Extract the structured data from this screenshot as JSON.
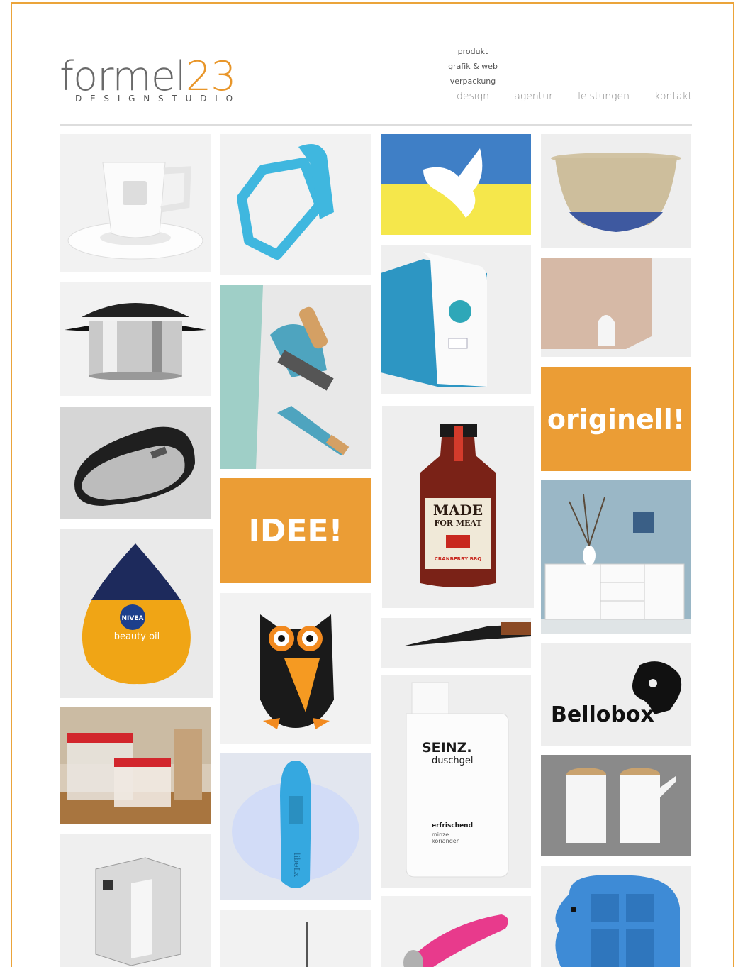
{
  "logo": {
    "word": "formel",
    "number": "23",
    "sub": "DESIGNSTUDIO"
  },
  "submenu": [
    "produkt",
    "grafik & web",
    "verpackung"
  ],
  "nav": [
    "design",
    "agentur",
    "leistungen",
    "kontakt"
  ],
  "tiles": {
    "idee": "IDEE!",
    "originell": "originell!",
    "bellobox": "Bellobox",
    "made_line1": "MADE",
    "made_line2": "FOR MEAT",
    "cranberry": "CRANBERRY BBQ",
    "nivea": "NIVEA",
    "beauty_oil": "beauty oil",
    "seinz": "SEINZ.",
    "duschgel": "duschgel",
    "erfrischend": "erfrischend",
    "minze": "minze",
    "koriander": "koriander",
    "libelx": "libeLx"
  },
  "colors": {
    "accent": "#eb9d35",
    "frame": "#eba43a",
    "text": "#6a6a6a"
  }
}
